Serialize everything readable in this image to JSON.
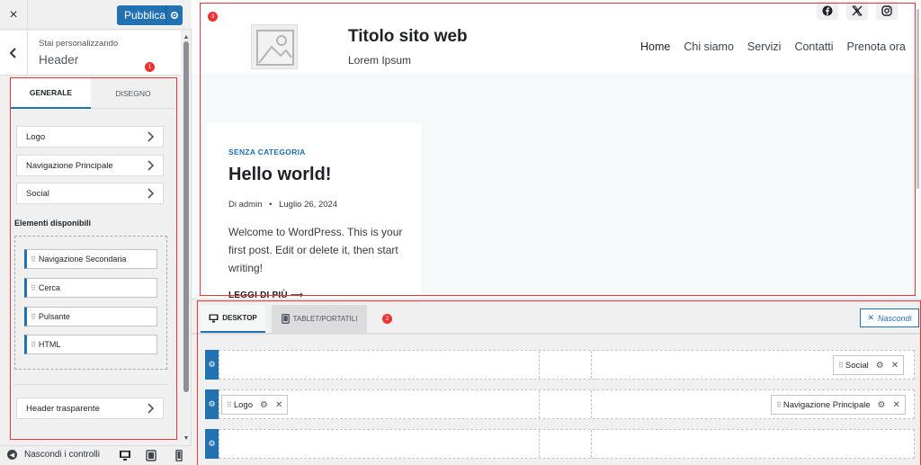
{
  "sidebar": {
    "close_icon": "×",
    "publish_label": "Pubblica",
    "customizing_label": "Stai personalizzando",
    "section_title": "Header",
    "tabs": {
      "general": "GENERALE",
      "design": "DISEGNO"
    },
    "sections": [
      {
        "label": "Logo"
      },
      {
        "label": "Navigazione Principale"
      },
      {
        "label": "Social"
      }
    ],
    "available_title": "Elementi disponibili",
    "available_items": [
      {
        "label": "Navigazione Secondaria"
      },
      {
        "label": "Cerca"
      },
      {
        "label": "Pulsante"
      },
      {
        "label": "HTML"
      }
    ],
    "transparent_header": "Header trasparente",
    "footer": {
      "hide_controls": "Nascondi i controlli"
    }
  },
  "markers": [
    "1",
    "2",
    "3"
  ],
  "preview": {
    "site_title": "Titolo sito web",
    "tagline": "Lorem Ipsum",
    "nav": [
      "Home",
      "Chi siamo",
      "Servizi",
      "Contatti",
      "Prenota ora"
    ],
    "social_icons": [
      "facebook-icon",
      "x-icon",
      "instagram-icon"
    ],
    "post": {
      "category": "SENZA CATEGORIA",
      "title": "Hello world!",
      "author": "Di admin",
      "date": "Luglio 26, 2024",
      "excerpt": "Welcome to WordPress. This is your first post. Edit or delete it, then start writing!",
      "read_more": "LEGGI DI PIÙ ⟶"
    }
  },
  "builder": {
    "tabs": {
      "desktop": "DESKTOP",
      "tablet": "TABLET/PORTATILI"
    },
    "hide_label": "Nascondi",
    "row_top_social": "Social",
    "row_main_logo": "Logo",
    "row_main_nav": "Navigazione Principale"
  },
  "colors": {
    "accent": "#2271b1",
    "marker": "#e33333"
  }
}
